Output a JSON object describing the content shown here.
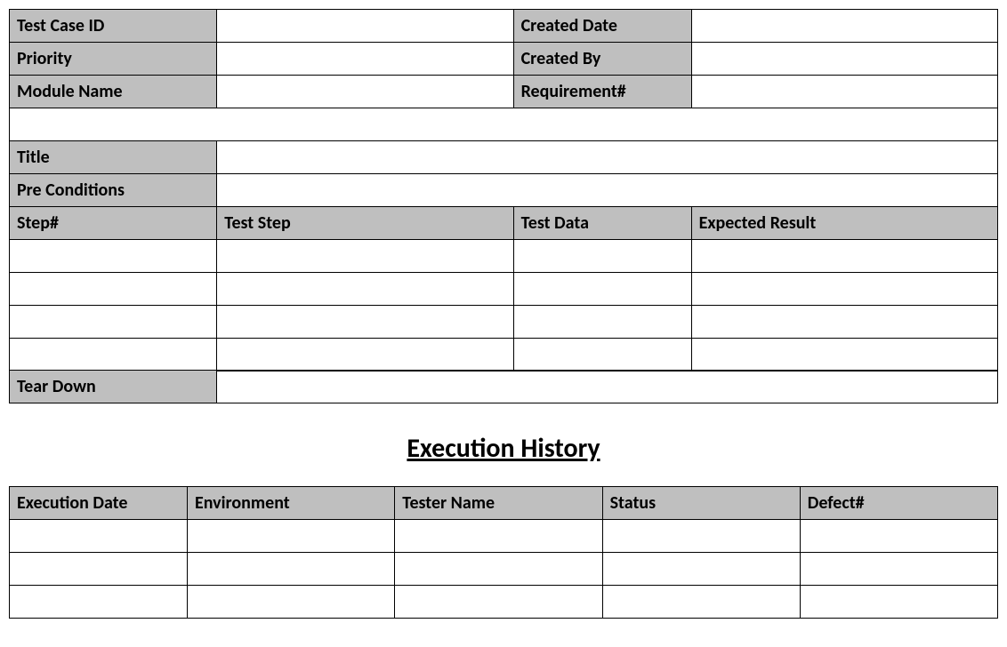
{
  "top": {
    "testCaseId": {
      "label": "Test Case ID",
      "value": ""
    },
    "createdDate": {
      "label": "Created Date",
      "value": ""
    },
    "priority": {
      "label": "Priority",
      "value": ""
    },
    "createdBy": {
      "label": "Created By",
      "value": ""
    },
    "moduleName": {
      "label": "Module Name",
      "value": ""
    },
    "requirementNo": {
      "label": "Requirement#",
      "value": ""
    },
    "title": {
      "label": "Title",
      "value": ""
    },
    "preConditions": {
      "label": "Pre Conditions",
      "value": ""
    },
    "tearDown": {
      "label": "Tear Down",
      "value": ""
    }
  },
  "stepsHeader": {
    "stepNo": "Step#",
    "testStep": "Test Step",
    "testData": "Test Data",
    "expectedResult": "Expected Result"
  },
  "steps": [
    {
      "stepNo": "",
      "testStep": "",
      "testData": "",
      "expectedResult": ""
    },
    {
      "stepNo": "",
      "testStep": "",
      "testData": "",
      "expectedResult": ""
    },
    {
      "stepNo": "",
      "testStep": "",
      "testData": "",
      "expectedResult": ""
    },
    {
      "stepNo": "",
      "testStep": "",
      "testData": "",
      "expectedResult": ""
    }
  ],
  "sectionTitle": "Execution History",
  "execHeader": {
    "executionDate": "Execution Date",
    "environment": "Environment",
    "testerName": "Tester Name",
    "status": "Status",
    "defectNo": "Defect#"
  },
  "execRows": [
    {
      "executionDate": "",
      "environment": "",
      "testerName": "",
      "status": "",
      "defectNo": ""
    },
    {
      "executionDate": "",
      "environment": "",
      "testerName": "",
      "status": "",
      "defectNo": ""
    },
    {
      "executionDate": "",
      "environment": "",
      "testerName": "",
      "status": "",
      "defectNo": ""
    }
  ]
}
